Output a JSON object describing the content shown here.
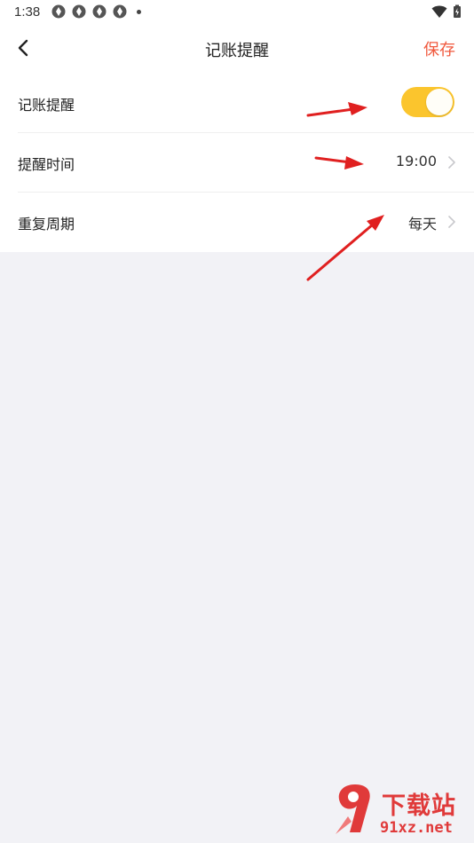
{
  "status_bar": {
    "time": "1:38"
  },
  "header": {
    "title": "记账提醒",
    "save_label": "保存"
  },
  "settings": [
    {
      "label": "记账提醒",
      "type": "toggle",
      "on": true
    },
    {
      "label": "提醒时间",
      "type": "value",
      "value": "19:00"
    },
    {
      "label": "重复周期",
      "type": "value",
      "value": "每天"
    }
  ],
  "colors": {
    "accent": "#f0593e",
    "toggle_on": "#fbc52d",
    "annotation_arrow": "#e02020"
  },
  "watermark": {
    "brand": "下载站",
    "domain": "91xz.net"
  }
}
